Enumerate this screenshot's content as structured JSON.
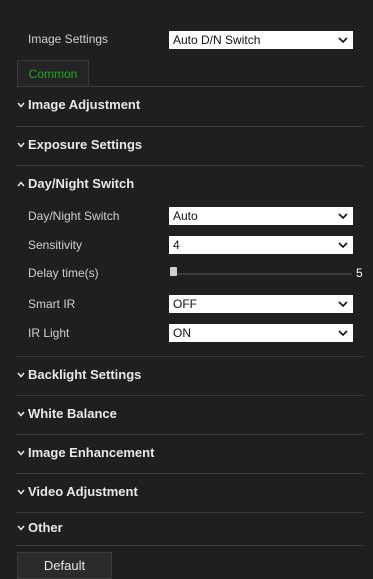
{
  "image_settings": {
    "label": "Image Settings",
    "selected": "Auto D/N Switch"
  },
  "tabs": [
    {
      "label": "Common",
      "active": true
    }
  ],
  "sections": {
    "image_adjustment": {
      "label": "Image Adjustment",
      "expanded": false
    },
    "exposure_settings": {
      "label": "Exposure Settings",
      "expanded": false
    },
    "day_night_switch": {
      "label": "Day/Night Switch",
      "expanded": true
    },
    "backlight_settings": {
      "label": "Backlight Settings",
      "expanded": false
    },
    "white_balance": {
      "label": "White Balance",
      "expanded": false
    },
    "image_enhancement": {
      "label": "Image Enhancement",
      "expanded": false
    },
    "video_adjustment": {
      "label": "Video Adjustment",
      "expanded": false
    },
    "other": {
      "label": "Other",
      "expanded": false
    }
  },
  "day_night_fields": {
    "mode": {
      "label": "Day/Night Switch",
      "value": "Auto"
    },
    "sensitivity": {
      "label": "Sensitivity",
      "value": "4"
    },
    "delay_time": {
      "label": "Delay time(s)",
      "value": "5",
      "slider_min": 5,
      "slider_max": 120
    },
    "smart_ir": {
      "label": "Smart IR",
      "value": "OFF"
    },
    "ir_light": {
      "label": "IR Light",
      "value": "ON"
    }
  },
  "buttons": {
    "default_label": "Default"
  },
  "colors": {
    "background": "#1f1f1f",
    "tab_active_text": "#1faa1f",
    "text": "#d0d0d0"
  },
  "icons": {
    "collapsed": "chevron-down-icon",
    "expanded": "chevron-up-icon",
    "dropdown": "chevron-down-icon"
  }
}
